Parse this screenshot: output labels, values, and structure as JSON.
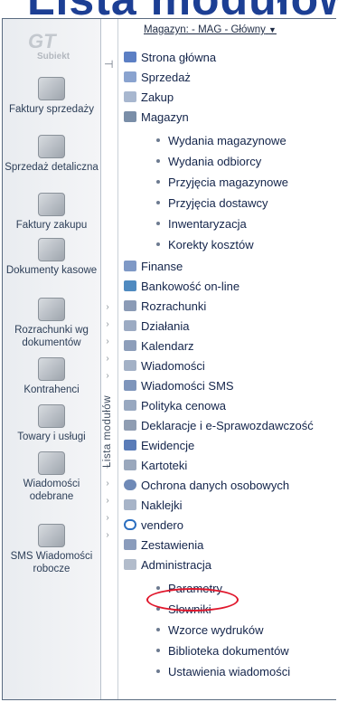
{
  "banner": {
    "title": "Lista modułów"
  },
  "logo": {
    "mark": "GT",
    "name": "Subiekt"
  },
  "left_nav": [
    {
      "label": "Faktury sprzedaży",
      "icon": "invoice-sales-icon"
    },
    {
      "label": "Sprzedaż detaliczna",
      "icon": "retail-sales-icon"
    },
    {
      "label": "Faktury zakupu",
      "icon": "invoice-purchase-icon"
    },
    {
      "label": "Dokumenty kasowe",
      "icon": "cash-documents-icon"
    },
    {
      "label": "Rozrachunki wg dokumentów",
      "icon": "settlements-icon"
    },
    {
      "label": "Kontrahenci",
      "icon": "contractors-icon"
    },
    {
      "label": "Towary i usługi",
      "icon": "goods-services-icon"
    },
    {
      "label": "Wiadomości odebrane",
      "icon": "messages-received-icon"
    },
    {
      "label": "SMS Wiadomości robocze",
      "icon": "sms-drafts-icon"
    }
  ],
  "side_tab": {
    "label": "Lista modułów"
  },
  "store_selector": {
    "label": "Magazyn: - MAG - Główny",
    "arrow": "▼"
  },
  "menu": {
    "strona_glowna": "Strona główna",
    "sprzedaz": "Sprzedaż",
    "zakup": "Zakup",
    "magazyn": "Magazyn",
    "magazyn_sub": [
      "Wydania magazynowe",
      "Wydania odbiorcy",
      "Przyjęcia magazynowe",
      "Przyjęcia dostawcy",
      "Inwentaryzacja",
      "Korekty kosztów"
    ],
    "rest": [
      "Finanse",
      "Bankowość on-line",
      "Rozrachunki",
      "Działania",
      "Kalendarz",
      "Wiadomości",
      "Wiadomości SMS",
      "Polityka cenowa",
      "Deklaracje i e-Sprawozdawczość",
      "Ewidencje",
      "Kartoteki",
      "Ochrona danych osobowych",
      "Naklejki",
      "vendero",
      "Zestawienia",
      "Administracja"
    ],
    "admin_sub": [
      "Parametry",
      "Słowniki",
      "Wzorce wydruków",
      "Biblioteka dokumentów",
      "Ustawienia wiadomości"
    ]
  },
  "colors": {
    "accent": "#1c3f94",
    "highlight": "#e0162b"
  }
}
